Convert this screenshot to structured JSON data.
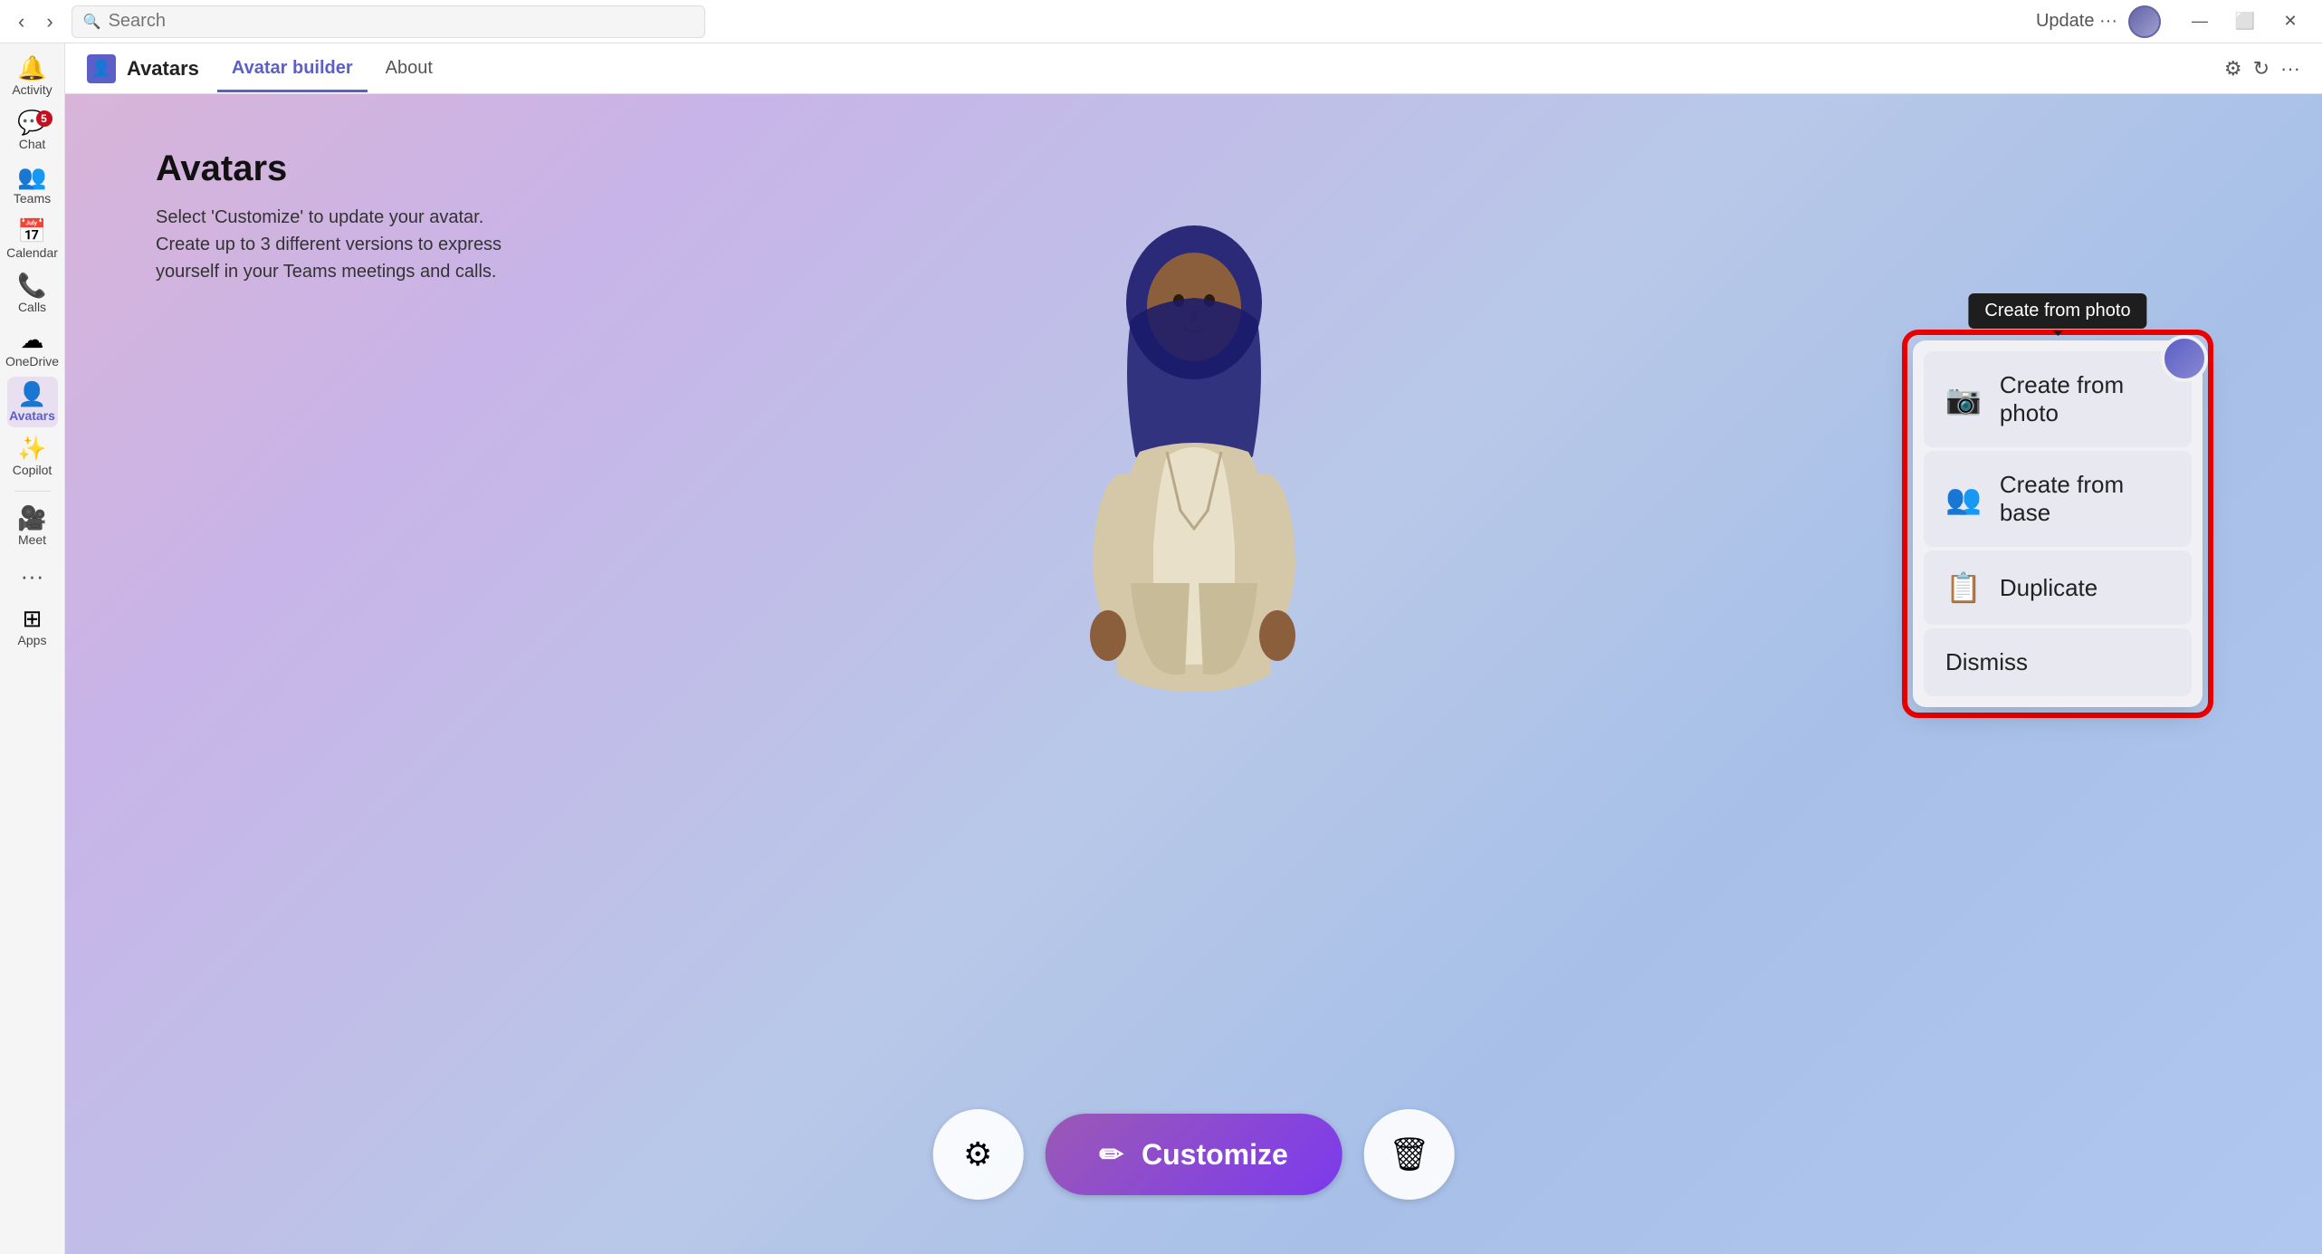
{
  "titlebar": {
    "nav_back": "‹",
    "nav_forward": "›",
    "search_placeholder": "Search",
    "update_label": "Update ···",
    "min_label": "—",
    "max_label": "⬜",
    "close_label": "✕",
    "settings_icon": "⚙",
    "refresh_icon": "↻",
    "more_icon": "···"
  },
  "sidebar": {
    "items": [
      {
        "id": "activity",
        "label": "Activity",
        "icon": "🔔",
        "badge": null
      },
      {
        "id": "chat",
        "label": "Chat",
        "icon": "💬",
        "badge": "5"
      },
      {
        "id": "teams",
        "label": "Teams",
        "icon": "👥",
        "badge": null
      },
      {
        "id": "calendar",
        "label": "Calendar",
        "icon": "📅",
        "badge": null
      },
      {
        "id": "calls",
        "label": "Calls",
        "icon": "📞",
        "badge": null
      },
      {
        "id": "onedrive",
        "label": "OneDrive",
        "icon": "☁",
        "badge": null
      },
      {
        "id": "avatars",
        "label": "Avatars",
        "icon": "👤",
        "badge": null,
        "active": true
      },
      {
        "id": "copilot",
        "label": "Copilot",
        "icon": "✨",
        "badge": null
      },
      {
        "id": "meet",
        "label": "Meet",
        "icon": "🎥",
        "badge": null
      },
      {
        "id": "apps",
        "label": "Apps",
        "icon": "⊞",
        "badge": null
      }
    ]
  },
  "tabs": {
    "app_icon": "👤",
    "app_name": "Avatars",
    "items": [
      {
        "id": "avatar-builder",
        "label": "Avatar builder",
        "active": true
      },
      {
        "id": "about",
        "label": "About",
        "active": false
      }
    ]
  },
  "page": {
    "title": "Avatars",
    "description_line1": "Select 'Customize' to update your avatar.",
    "description_line2": "Create up to 3 different versions to express",
    "description_line3": "yourself in your Teams meetings and calls."
  },
  "bottom_bar": {
    "settings_icon": "⚙",
    "customize_icon": "✏",
    "customize_label": "Customize",
    "delete_icon": "🗑"
  },
  "context_menu": {
    "tooltip": "Create from photo",
    "items": [
      {
        "id": "create-from-photo",
        "icon": "📷",
        "label": "Create from photo"
      },
      {
        "id": "create-from-base",
        "icon": "👥",
        "label": "Create from base"
      },
      {
        "id": "duplicate",
        "icon": "📋",
        "label": "Duplicate"
      },
      {
        "id": "dismiss",
        "icon": null,
        "label": "Dismiss"
      }
    ]
  }
}
